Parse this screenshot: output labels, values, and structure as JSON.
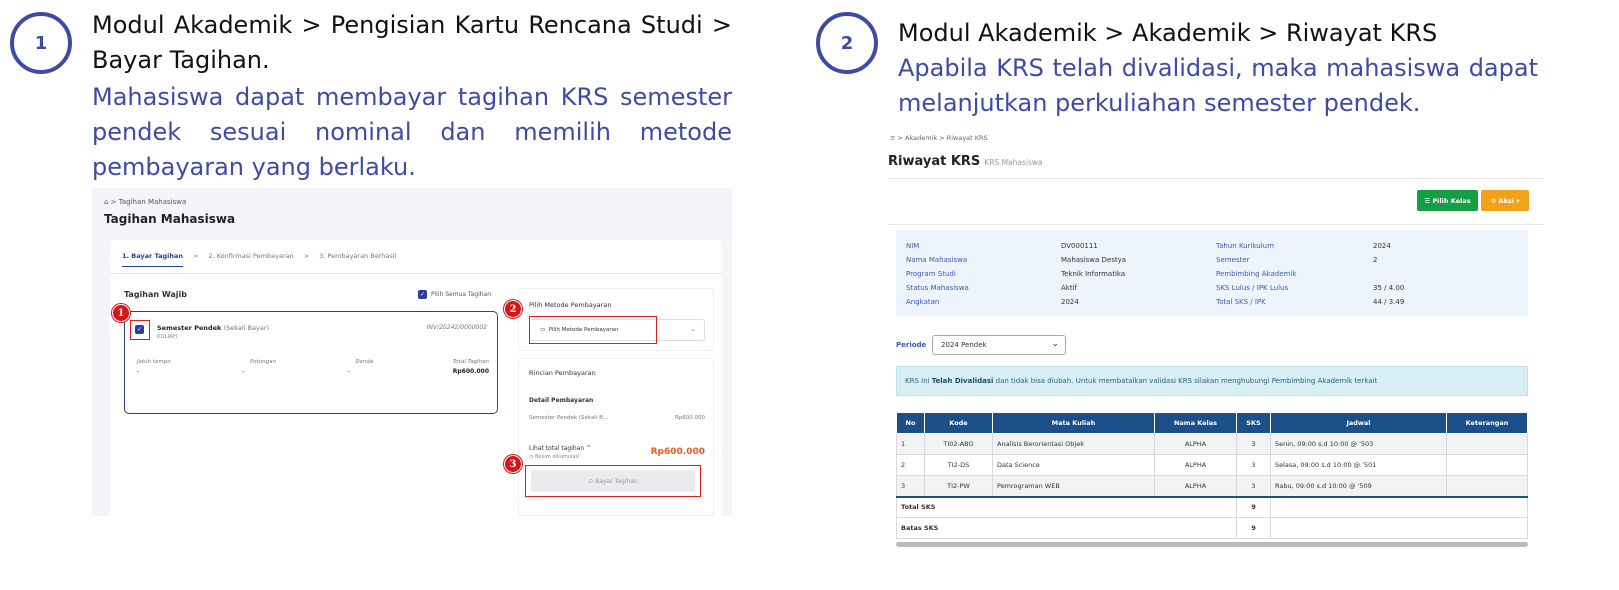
{
  "steps": [
    {
      "number": "1",
      "heading": "Modul Akademik > Pengisian Kartu Rencana Studi > Bayar Tagihan.",
      "description": "Mahasiswa dapat membayar tagihan KRS semester pendek sesuai nominal dan memilih metode pembayaran yang berlaku."
    },
    {
      "number": "2",
      "heading": "Modul Akademik > Akademik > Riwayat KRS",
      "description": "Apabila KRS telah divalidasi, maka mahasiswa dapat melanjutkan perkuliahan semester pendek."
    }
  ],
  "shot1": {
    "breadcrumb": "⌂  >  Tagihan Mahasiswa",
    "page_title": "Tagihan Mahasiswa",
    "tabs": [
      "1. Bayar Tagihan",
      "2. Konfirmasi Pembayaran",
      "3. Pembayaran Berhasil"
    ],
    "tab_separator": ">",
    "tagihan_wajib": "Tagihan Wajib",
    "pilih_semua": "Pilih Semua Tagihan",
    "bill": {
      "name": "Semester Pendek",
      "name_note": "(Sekali Bayar)",
      "sub": "KULIAH",
      "invoice": "INV/20242/0000002",
      "col_headers": [
        "Jatuh tempo",
        "Potongan",
        "Denda",
        "Total Tagihan"
      ],
      "col_values": [
        "-",
        "-",
        "-",
        "Rp600.000"
      ]
    },
    "badges": [
      "1",
      "2",
      "3"
    ],
    "payment_method_title": "Pilih Metode Pembayaran",
    "payment_method_placeholder": "Pilih Metode Pembayaran",
    "rincian_title": "Rincian Pembayaran",
    "detail_title": "Detail Pembayaran",
    "detail_label": "Semester Pendek (Sekali B...",
    "detail_value": "Rp600.000",
    "lihat_total": "Lihat total tagihan ^",
    "lihat_note": "◷ Belum dikumulasi",
    "total_value": "Rp600.000",
    "pay_button": "⊙  Bayar Tagihan"
  },
  "shot2": {
    "breadcrumb": "≡  >  Akademik  >  Riwayat KRS",
    "page_title": "Riwayat KRS",
    "page_subtitle": "KRS Mahasiswa",
    "btn_pilih_kelas": "☰ Pilih Kelas",
    "btn_aksi": "⚙ Aksi ▾",
    "info": [
      {
        "k1": "NIM",
        "v1": "DV000111",
        "k2": "Tahun Kurikulum",
        "v2": "2024"
      },
      {
        "k1": "Nama Mahasiswa",
        "v1": "Mahasiswa Destya",
        "k2": "Semester",
        "v2": "2"
      },
      {
        "k1": "Program Studi",
        "v1": "Teknik Informatika",
        "k2": "Pembimbing Akademik",
        "v2": ""
      },
      {
        "k1": "Status Mahasiswa",
        "v1": "Aktif",
        "k2": "SKS Lulus / IPK Lulus",
        "v2": "35 / 4.00"
      },
      {
        "k1": "Angkatan",
        "v1": "2024",
        "k2": "Total SKS / IPK",
        "v2": "44 / 3.49"
      }
    ],
    "periode_label": "Periode",
    "periode_value": "2024 Pendek",
    "alert_pre": "KRS ini ",
    "alert_bold": "Telah Divalidasi",
    "alert_post": " dan tidak bisa diubah. Untuk membatalkan validasi KRS silakan menghubungi Pembimbing Akademik terkait",
    "table": {
      "headers": [
        "No",
        "Kode",
        "Mata Kuliah",
        "Nama Kelas",
        "SKS",
        "Jadwal",
        "Keterangan"
      ],
      "rows": [
        [
          "1",
          "TI02-ABO",
          "Analisis Berorientasi Objek",
          "ALPHA",
          "3",
          "Senin, 09:00 s.d 10:00 @ '503",
          ""
        ],
        [
          "2",
          "TI2-DS",
          "Data Science",
          "ALPHA",
          "3",
          "Selasa, 09:00 s.d 10:00 @ '501",
          ""
        ],
        [
          "3",
          "TI2-PW",
          "Pemrograman WEB",
          "ALPHA",
          "3",
          "Rabu, 09:00 s.d 10:00 @ '509",
          ""
        ]
      ],
      "total_sks_label": "Total SKS",
      "total_sks_value": "9",
      "batas_sks_label": "Batas SKS",
      "batas_sks_value": "9"
    }
  }
}
